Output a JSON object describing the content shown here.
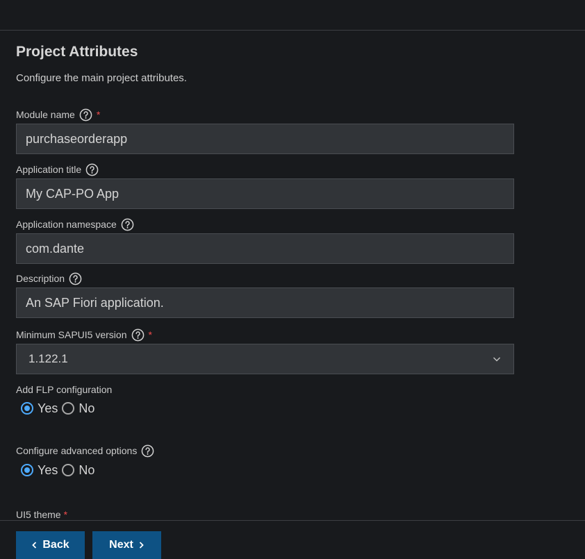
{
  "page": {
    "title": "Project Attributes",
    "subtitle": "Configure the main project attributes."
  },
  "fields": {
    "module_name": {
      "label": "Module name",
      "value": "purchaseorderapp",
      "required": "*"
    },
    "app_title": {
      "label": "Application title",
      "value": "My CAP-PO App"
    },
    "app_namespace": {
      "label": "Application namespace",
      "value": "com.dante"
    },
    "description": {
      "label": "Description",
      "value": "An SAP Fiori application."
    },
    "min_ui5": {
      "label": "Minimum SAPUI5 version",
      "value": "1.122.1",
      "required": "*"
    },
    "flp_config": {
      "label": "Add FLP configuration",
      "yes": "Yes",
      "no": "No",
      "selected": "Yes"
    },
    "advanced": {
      "label": "Configure advanced options",
      "yes": "Yes",
      "no": "No",
      "selected": "Yes"
    },
    "ui5_theme": {
      "label": "UI5 theme",
      "required": "*"
    }
  },
  "footer": {
    "back_label": "Back",
    "next_label": "Next"
  },
  "colors": {
    "background": "#181a1d",
    "field_bg": "#313438",
    "accent": "#4daafc",
    "button": "#0e5284",
    "required": "#f14c4c"
  }
}
